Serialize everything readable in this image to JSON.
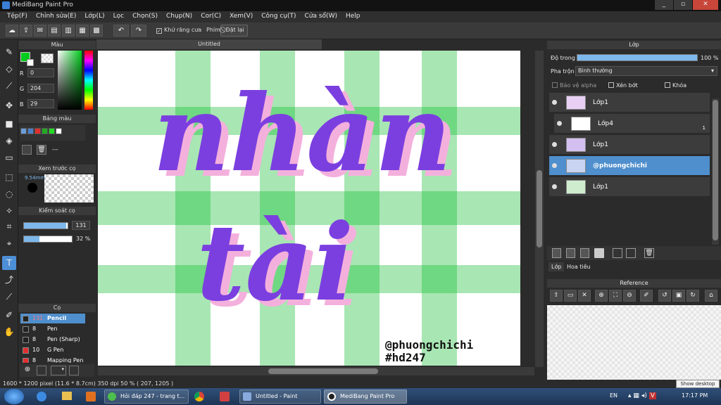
{
  "window": {
    "title": "MediBang Paint Pro",
    "buttons": [
      "_",
      "▫",
      "✕"
    ]
  },
  "menu": [
    "Tệp(F)",
    "Chỉnh sửa(E)",
    "Lớp(L)",
    "Lọc",
    "Chọn(S)",
    "Chụp(N)",
    "Cor(C)",
    "Xem(V)",
    "Công cụ(T)",
    "Cửa sổ(W)",
    "Help"
  ],
  "toolbar": {
    "antialias_label": "Khử răng cưa",
    "phim_label": "Phím",
    "reset_label": "Đặt lại"
  },
  "document": {
    "tab_title": "Untitled"
  },
  "color_panel": {
    "title": "Màu",
    "r_label": "R",
    "r_value": "0",
    "g_label": "G",
    "g_value": "204",
    "b_label": "B",
    "b_value": "29",
    "fg_color": "#00cc1d"
  },
  "palette_panel": {
    "title": "Bảng màu",
    "colors": [
      "#6b9cd6",
      "#4a7ec8",
      "#e03030",
      "#22aa22",
      "#22dd22",
      "#ffffff"
    ],
    "dashes": "---"
  },
  "preview_panel": {
    "title": "Xem trước cọ",
    "size_text": "9.54mm"
  },
  "brush_control": {
    "title": "Kiểm soát cọ",
    "size_value": "131",
    "size_fraction": 0.97,
    "opacity_value": "32 %",
    "opacity_fraction": 0.32
  },
  "brush_panel": {
    "title": "Cọ",
    "brushes": [
      {
        "color": "#222222",
        "size": "131",
        "name": "Pencil",
        "selected": true
      },
      {
        "color": "#222222",
        "size": "8",
        "name": "Pen"
      },
      {
        "color": "#222222",
        "size": "8",
        "name": "Pen (Sharp)"
      },
      {
        "color": "#e03030",
        "size": "10",
        "name": "G Pen"
      },
      {
        "color": "#e03030",
        "size": "8",
        "name": "Mapping Pen"
      }
    ]
  },
  "layers_panel": {
    "title": "Lớp",
    "opacity_label": "Độ trong",
    "opacity_value": "100 %",
    "opacity_fraction": 1.0,
    "blend_label": "Pha trộn",
    "blend_value": "Bình thường",
    "protect_alpha": "Bảo vệ alpha",
    "clipping": "Xén bớt",
    "lock": "Khóa",
    "layers": [
      {
        "name": "Lớp1",
        "selected": false,
        "indent": false
      },
      {
        "name": "Lớp4",
        "selected": false,
        "indent": true,
        "badge": "1"
      },
      {
        "name": "Lớp1",
        "selected": false,
        "indent": false
      },
      {
        "name": "@phuongchichi",
        "selected": true,
        "indent": false
      },
      {
        "name": "Lớp1",
        "selected": false,
        "indent": false
      }
    ],
    "tabs": [
      "Lớp",
      "Hoa tiêu"
    ]
  },
  "reference_panel": {
    "title": "Reference"
  },
  "canvas": {
    "line1": "nhàn",
    "line2": "tài",
    "signature1": "@phuongchichi",
    "signature2": "#hd247"
  },
  "status": {
    "text": "1600 * 1200 pixel  (11.6 * 8.7cm)  350 dpi  50 %  ( 207, 1205 )"
  },
  "taskbar": {
    "items": [
      "Hỏi đáp 247 - trang t...",
      "Untitled - Paint",
      "MediBang Paint Pro"
    ],
    "lang": "EN",
    "time": "17:17 PM",
    "tooltip": "Show desktop"
  }
}
